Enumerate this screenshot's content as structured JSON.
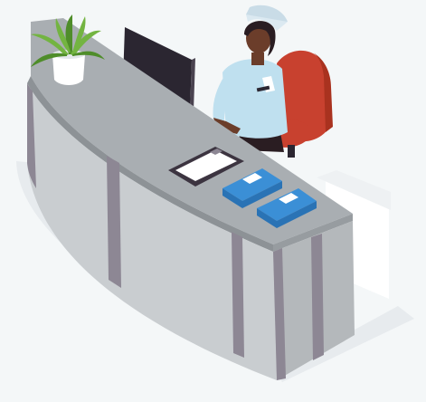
{
  "scene": {
    "subject": "reception-desk",
    "colors": {
      "background": "#f4f7f8",
      "floor_shadow": "#e7ebee",
      "desk_top": "#a9aeb2",
      "desk_top_edge": "#8d9296",
      "desk_panel": "#c9cdd0",
      "desk_panel_dark": "#b4b8bb",
      "desk_post": "#8d8794",
      "wall_white": "#ffffff",
      "monitor": "#2b2631",
      "monitor_side": "#4a4350",
      "chair": "#c8412f",
      "chair_dark": "#a9321f",
      "uniform": "#bfe0ef",
      "skin": "#6b3d2a",
      "hair": "#2a1d22",
      "cap": "#dbe9f1",
      "clipboard": "#3c3440",
      "paper": "#ffffff",
      "folder": "#3b8fd6",
      "folder_dark": "#2a73b5",
      "plant_pot": "#ffffff",
      "leaves": "#73b441",
      "leaves_dark": "#4f8d2a"
    },
    "icons": [
      "potted-plant-icon",
      "computer-monitor-icon",
      "receptionist-nurse-icon",
      "office-chair-icon",
      "clipboard-icon",
      "folder-icon"
    ]
  }
}
